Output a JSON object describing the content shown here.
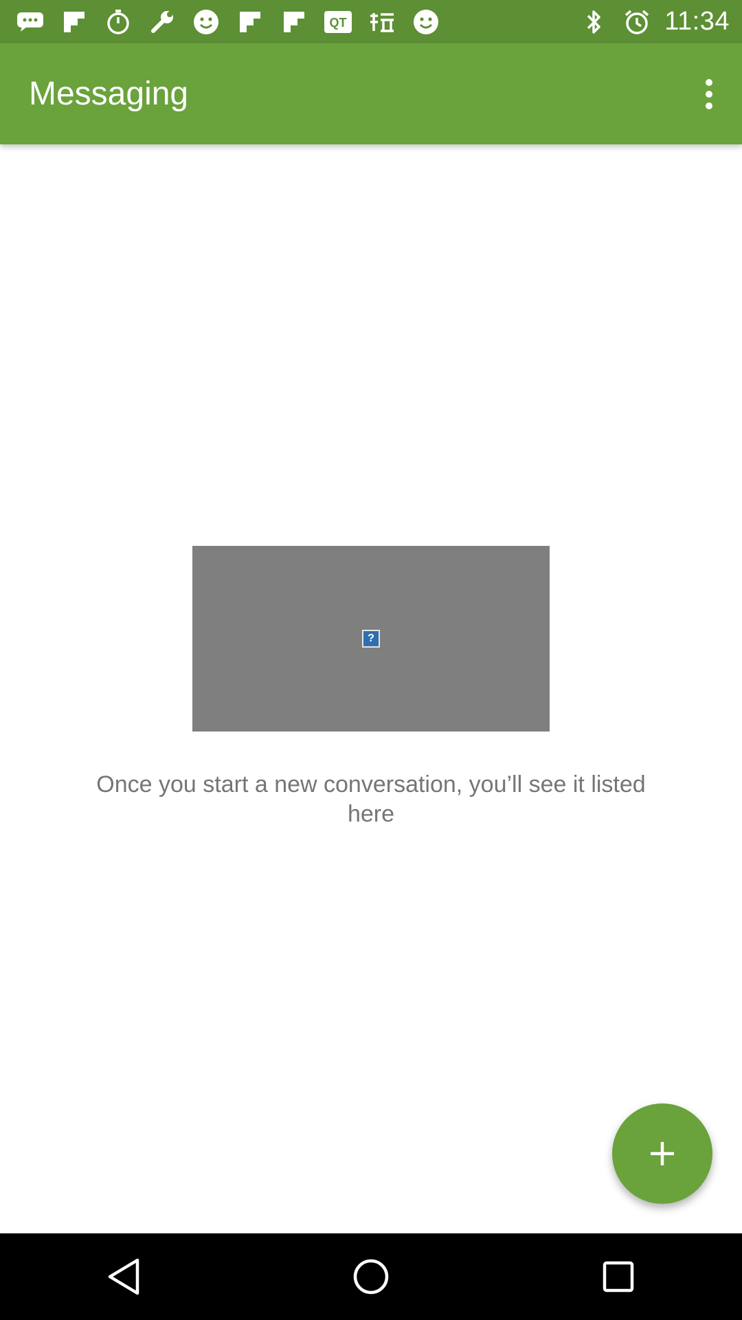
{
  "status_bar": {
    "time": "11:34",
    "left_icons": [
      "chat-bubble-icon",
      "flipboard-icon",
      "stopwatch-icon",
      "wrench-icon",
      "smiley-icon",
      "flipboard-icon",
      "flipboard-icon",
      "qt-icon",
      "taobao-icon",
      "smiley-icon"
    ],
    "right_icons": [
      "bluetooth-icon",
      "alarm-icon"
    ]
  },
  "app_bar": {
    "title": "Messaging",
    "overflow_icon": "more-vert-icon"
  },
  "content": {
    "empty_message": "Once you start a new conversation, you’ll see it listed here",
    "broken_image_glyph": "?"
  },
  "fab": {
    "icon": "plus-icon"
  },
  "nav_bar": {
    "buttons": [
      "back-icon",
      "home-icon",
      "recents-icon"
    ]
  },
  "colors": {
    "status_bar": "#5d8f34",
    "app_bar": "#6aa23c",
    "fab": "#6aa23c",
    "placeholder": "#7f7f7f",
    "message_text": "#757575"
  }
}
